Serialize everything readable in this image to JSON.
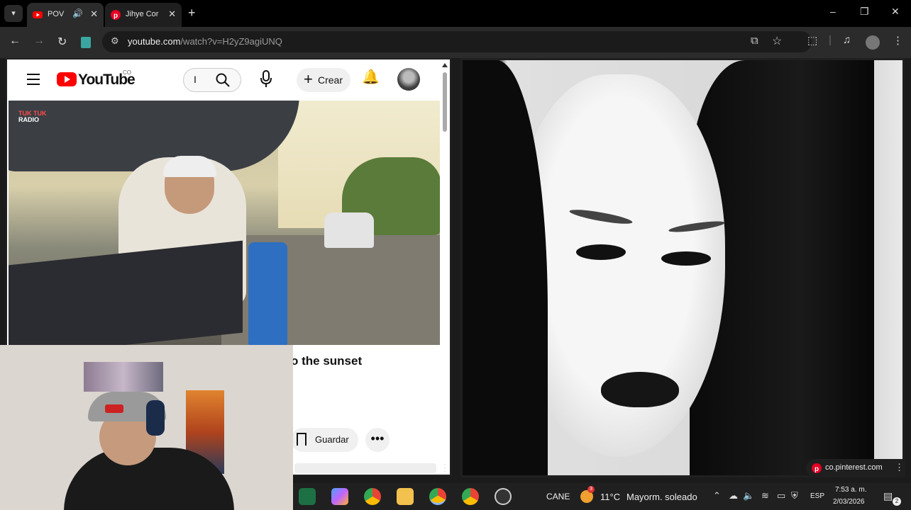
{
  "browser": {
    "tabs": [
      {
        "label": "POV",
        "audio_icon": "speaker-icon",
        "active": true
      },
      {
        "label": "Jihye Cor",
        "active": false
      }
    ],
    "new_tab": "+",
    "window_controls": {
      "minimize": "–",
      "maximize": "❐",
      "close": "✕"
    },
    "url": {
      "host": "youtube.com",
      "path": "/watch?v=H2yZ9agiUNQ"
    }
  },
  "youtube": {
    "logo_text": "YouTube",
    "region": "CO",
    "search_value": "I",
    "create_label": "Crear",
    "video_badge": {
      "line1": "TUK TUK",
      "line2": "RADIO"
    },
    "title_fragment": "o the sunset",
    "save_label": "Guardar",
    "more_label": "•••"
  },
  "pinterest": {
    "link_label": "co.pinterest.com"
  },
  "taskbar": {
    "search_label": "CANE",
    "weather_badge": "3",
    "temperature": "11°C",
    "weather": "Mayorm. soleado",
    "language": "ESP",
    "time": "7:53 a. m.",
    "date": "2/03/2026",
    "notification_count": "2"
  }
}
